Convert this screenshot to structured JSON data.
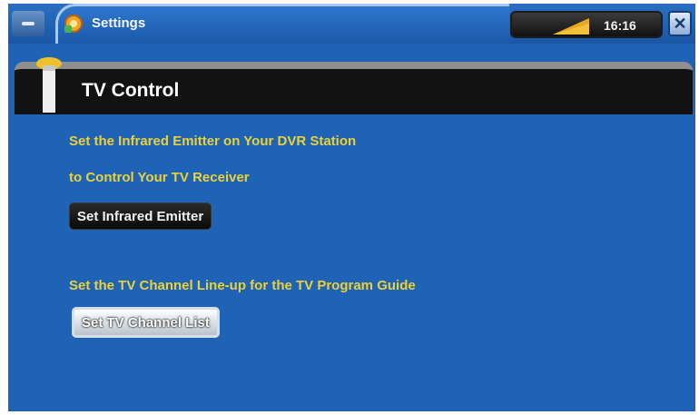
{
  "statusbar": {
    "app_title": "Settings",
    "counter": "16:16",
    "close_symbol": "✕"
  },
  "section": {
    "title": "TV Control"
  },
  "content": {
    "infrared_line1": "Set the Infrared Emitter on Your DVR Station",
    "infrared_line2": "to Control Your TV Receiver",
    "infrared_button": "Set Infrared Emitter",
    "channel_line": "Set the TV Channel Line-up for the TV Program Guide",
    "channel_button": "Set TV Channel List"
  },
  "colors": {
    "background": "#1f63b7",
    "text_accent": "#e9d238",
    "header": "#121212"
  },
  "icons": {
    "menu": "menu-icon",
    "settings": "settings-icon",
    "signal": "signal-strength-icon",
    "close": "close-icon",
    "section": "tv-emitter-icon"
  }
}
